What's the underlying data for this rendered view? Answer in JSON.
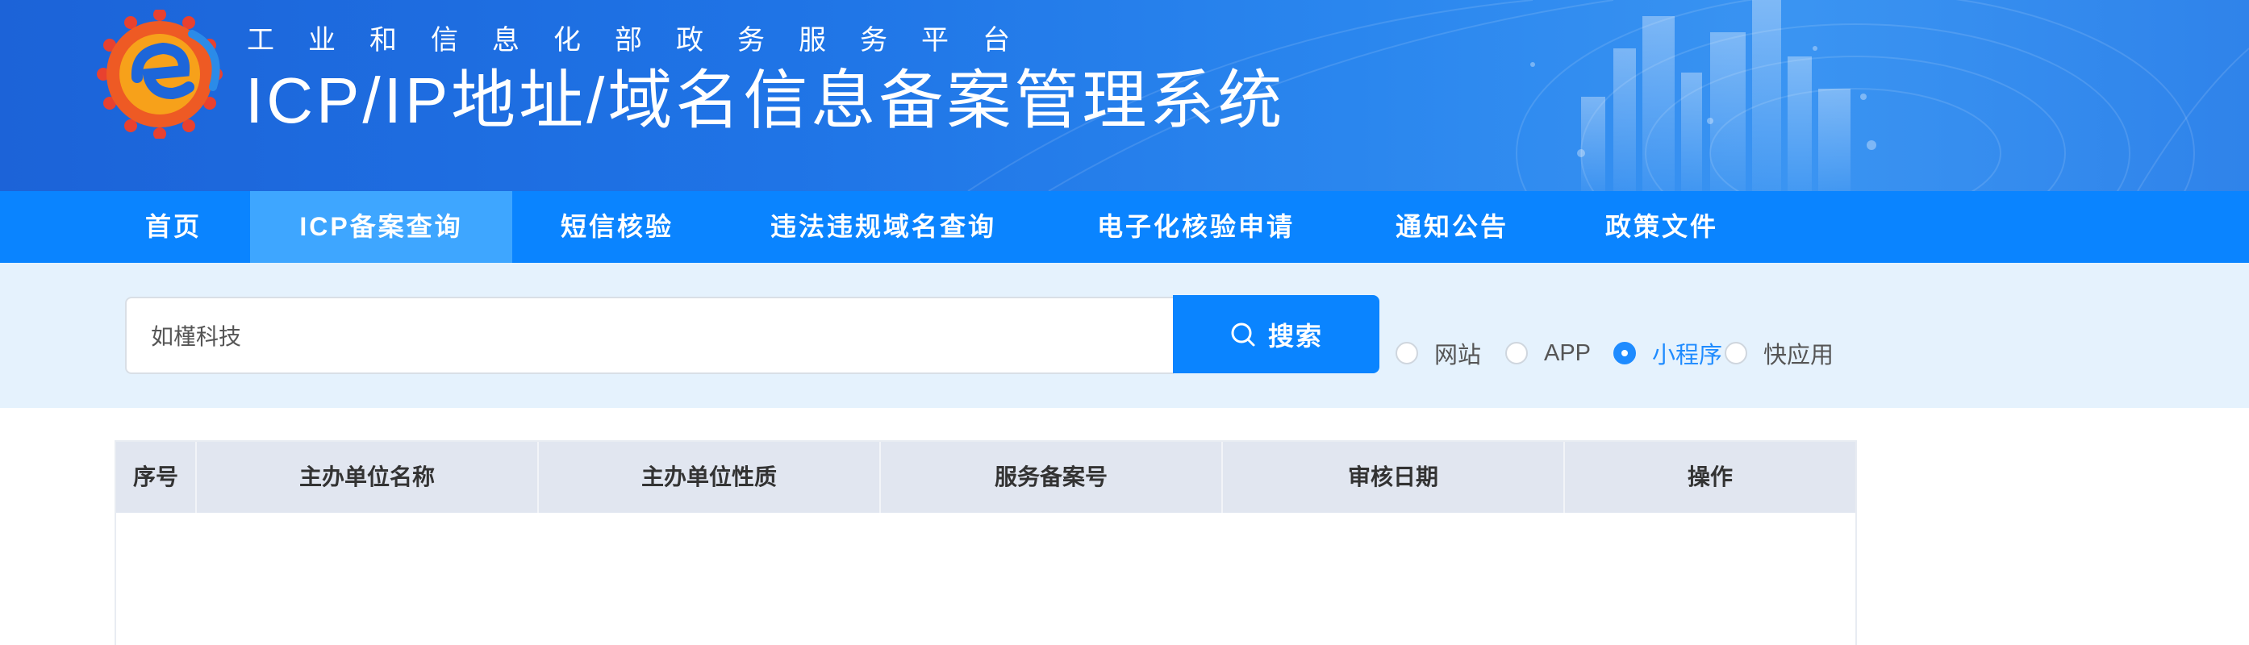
{
  "header": {
    "subtitle": "工业和信息化部政务服务平台",
    "title": "ICP/IP地址/域名信息备案管理系统"
  },
  "nav": {
    "items": [
      {
        "label": "首页"
      },
      {
        "label": "ICP备案查询",
        "active": true
      },
      {
        "label": "短信核验"
      },
      {
        "label": "违法违规域名查询"
      },
      {
        "label": "电子化核验申请"
      },
      {
        "label": "通知公告"
      },
      {
        "label": "政策文件"
      }
    ]
  },
  "search": {
    "value": "如槿科技",
    "button_label": "搜索",
    "types": [
      {
        "label": "网站",
        "checked": false
      },
      {
        "label": "APP",
        "checked": false
      },
      {
        "label": "小程序",
        "checked": true
      },
      {
        "label": "快应用",
        "checked": false
      }
    ]
  },
  "table": {
    "columns": [
      "序号",
      "主办单位名称",
      "主办单位性质",
      "服务备案号",
      "审核日期",
      "操作"
    ],
    "rows": []
  },
  "colors": {
    "nav_bg": "#0a84ff",
    "nav_active": "#3ea6ff",
    "accent": "#1e8bff",
    "search_band": "#e5f2fd",
    "table_header": "#e1e6f0"
  }
}
